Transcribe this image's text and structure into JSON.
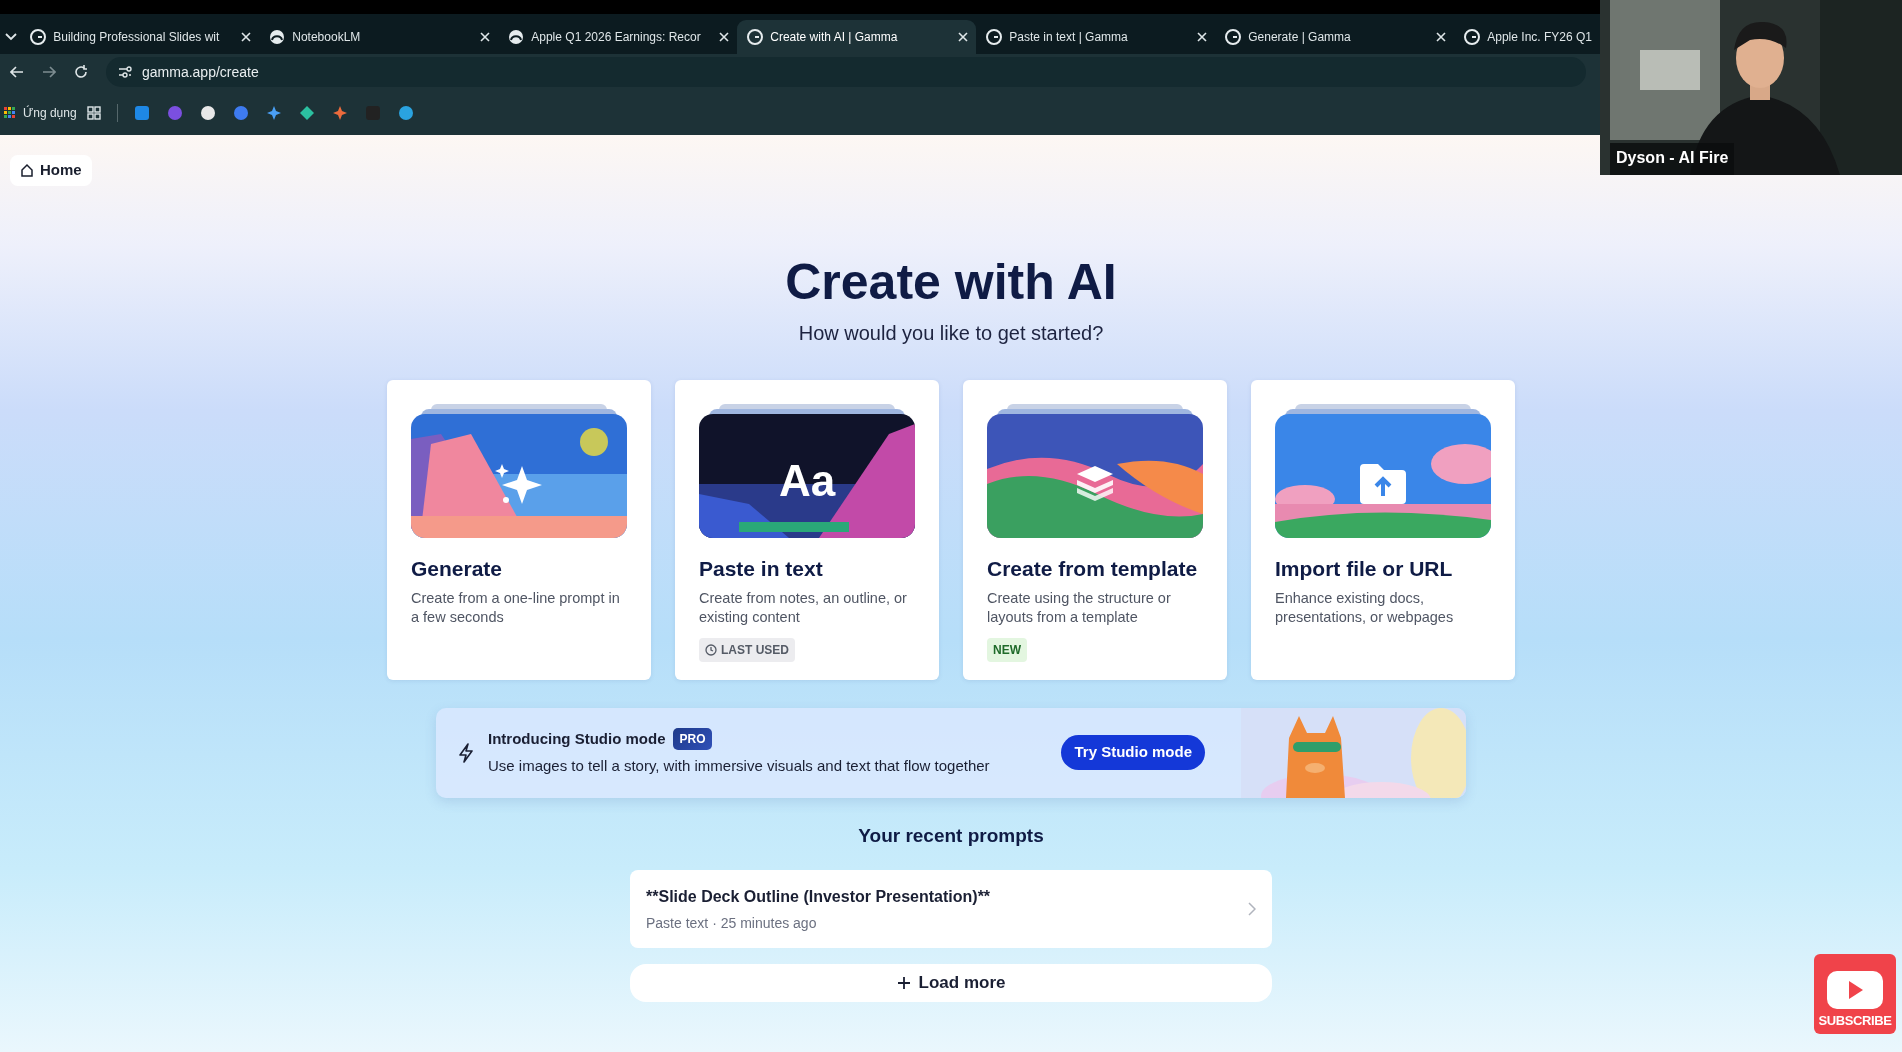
{
  "browser": {
    "tabs": [
      {
        "title": "Building Professional Slides wit",
        "kind": "gamma",
        "selected": false,
        "closable": true
      },
      {
        "title": "NotebookLM",
        "kind": "notebook",
        "selected": false,
        "closable": true
      },
      {
        "title": "Apple Q1 2026 Earnings: Recor",
        "kind": "notebook",
        "selected": false,
        "closable": true
      },
      {
        "title": "Create with AI | Gamma",
        "kind": "gamma",
        "selected": true,
        "closable": true
      },
      {
        "title": "Paste in text | Gamma",
        "kind": "gamma",
        "selected": false,
        "closable": true
      },
      {
        "title": "Generate | Gamma",
        "kind": "gamma",
        "selected": false,
        "closable": true
      },
      {
        "title": "Apple Inc. FY26 Q1",
        "kind": "gamma",
        "selected": false,
        "closable": false,
        "last": true
      }
    ],
    "url": "gamma.app/create",
    "bookmarks": {
      "apps_label": "Ứng dụng"
    }
  },
  "page": {
    "home": "Home",
    "title": "Create with AI",
    "subtitle": "How would you like to get started?",
    "cards": [
      {
        "kind": "generate",
        "title": "Generate",
        "description": "Create from a one-line prompt in a few seconds"
      },
      {
        "kind": "paste",
        "title": "Paste in text",
        "art_text": "Aa",
        "description": "Create from notes, an outline, or existing content",
        "badge": {
          "kind": "recent",
          "text": "LAST USED"
        }
      },
      {
        "kind": "template",
        "title": "Create from template",
        "description": "Create using the structure or layouts from a template",
        "badge": {
          "kind": "new",
          "text": "NEW"
        }
      },
      {
        "kind": "import",
        "title": "Import file or URL",
        "description": "Enhance existing docs, presentations, or webpages"
      }
    ],
    "banner": {
      "title": "Introducing Studio mode",
      "badge": "PRO",
      "text": "Use images to tell a story, with immersive visuals and text that flow together",
      "button": "Try Studio mode"
    },
    "recent": {
      "heading": "Your recent prompts",
      "items": [
        {
          "title": "**Slide Deck Outline (Investor Presentation)**",
          "meta": "Paste text · 25 minutes ago"
        }
      ],
      "load_more": "Load more"
    }
  },
  "overlay": {
    "webcam_caption": "Dyson - AI Fire",
    "subscribe": "SUBSCRIBE"
  }
}
